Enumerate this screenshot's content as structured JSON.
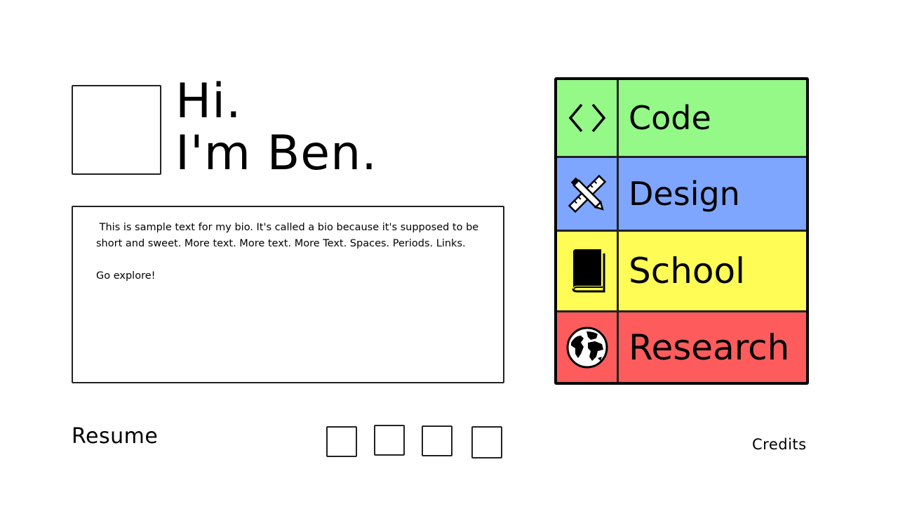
{
  "header": {
    "greeting_line1": "Hi.",
    "greeting_line2": "I'm Ben."
  },
  "bio": {
    "paragraph1": " This is sample text for my bio. It's called a bio because it's supposed to be short and sweet. More text. More text. More Text. Spaces. Periods. Links.",
    "paragraph2": "Go explore!"
  },
  "menu": {
    "items": [
      {
        "label": "Code",
        "icon": "code-brackets-icon",
        "color": "#94f987"
      },
      {
        "label": "Design",
        "icon": "pencil-ruler-icon",
        "color": "#7ea6ff"
      },
      {
        "label": "School",
        "icon": "book-icon",
        "color": "#fefc55"
      },
      {
        "label": "Research",
        "icon": "globe-icon",
        "color": "#fe5c5c"
      }
    ]
  },
  "footer": {
    "resume_label": "Resume",
    "credits_label": "Credits"
  }
}
